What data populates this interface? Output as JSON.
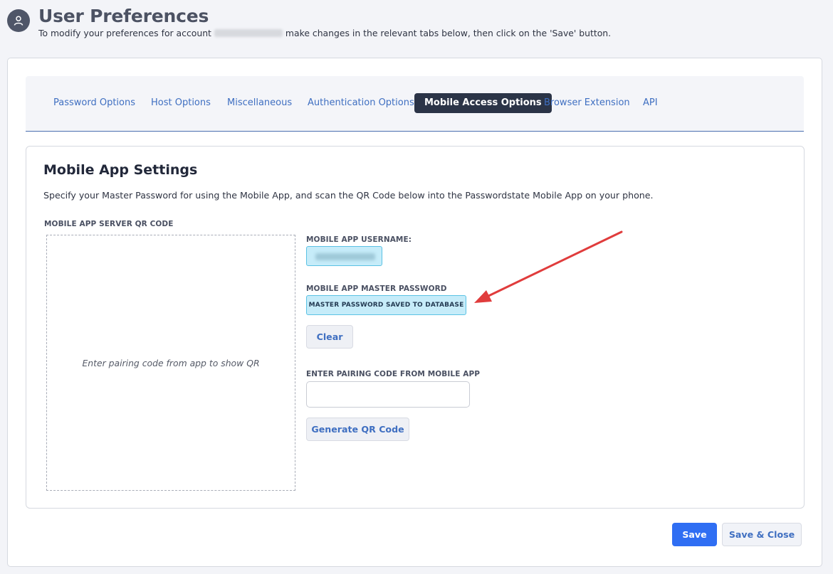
{
  "header": {
    "title": "User Preferences",
    "subtitle_before": "To modify your preferences for account",
    "subtitle_after": "make changes in the relevant tabs below, then click on the 'Save' button.",
    "avatar_icon": "user-icon"
  },
  "tabs": [
    {
      "label": "Password Options",
      "active": false
    },
    {
      "label": "Host Options",
      "active": false
    },
    {
      "label": "Miscellaneous",
      "active": false
    },
    {
      "label": "Authentication Options",
      "active": false
    },
    {
      "label": "Mobile Access Options",
      "active": true
    },
    {
      "label": "Browser Extension",
      "active": false
    },
    {
      "label": "API",
      "active": false
    }
  ],
  "mobile_settings": {
    "title": "Mobile App Settings",
    "description": "Specify your Master Password for using the Mobile App, and scan the QR Code below into the Passwordstate Mobile App on your phone.",
    "qr_label": "MOBILE APP SERVER QR CODE",
    "qr_hint": "Enter pairing code from app to show QR",
    "username_label": "MOBILE APP USERNAME:",
    "master_password_label": "MOBILE APP MASTER PASSWORD",
    "master_password_status": "MASTER PASSWORD SAVED TO DATABASE",
    "clear_button": "Clear",
    "pairing_label": "ENTER PAIRING CODE FROM MOBILE APP",
    "pairing_value": "",
    "generate_button": "Generate QR Code"
  },
  "footer": {
    "save_button": "Save",
    "save_close_button": "Save & Close"
  },
  "colors": {
    "accent": "#2f6ef3",
    "tab_active_bg": "#2b3447",
    "link": "#3f6fc1",
    "badge_bg": "#c6ecf9",
    "annotation_arrow": "#e03c3c"
  }
}
